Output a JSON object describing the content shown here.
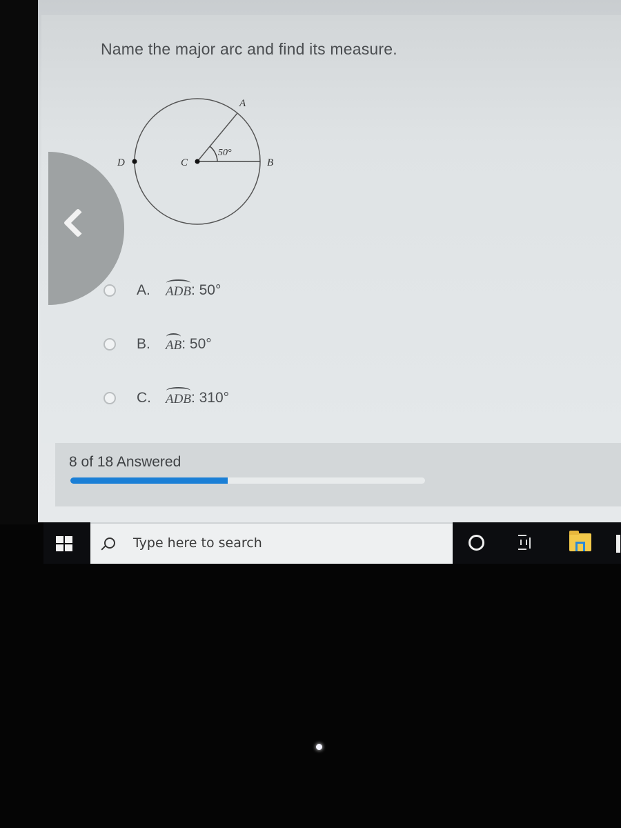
{
  "question": {
    "prompt": "Name the major arc and find its measure."
  },
  "diagram": {
    "points": {
      "A": "A",
      "B": "B",
      "C": "C",
      "D": "D"
    },
    "angle_label": "50°",
    "central_angle_deg": 50
  },
  "choices": [
    {
      "letter": "A.",
      "arc": "ADB",
      "measure": ": 50°",
      "selected": false
    },
    {
      "letter": "B.",
      "arc": "AB",
      "measure": ": 50°",
      "selected": false
    },
    {
      "letter": "C.",
      "arc": "ADB",
      "measure": ": 310°",
      "selected": false
    }
  ],
  "navigation": {
    "back_icon": "chevron-left-icon"
  },
  "progress": {
    "label": "8 of 18 Answered",
    "answered": 8,
    "total": 18,
    "fill_color": "#1a7fd6"
  },
  "taskbar": {
    "start_icon": "windows-icon",
    "search_placeholder": "Type here to search",
    "icons": [
      "cortana-icon",
      "task-view-icon",
      "file-explorer-icon"
    ]
  }
}
